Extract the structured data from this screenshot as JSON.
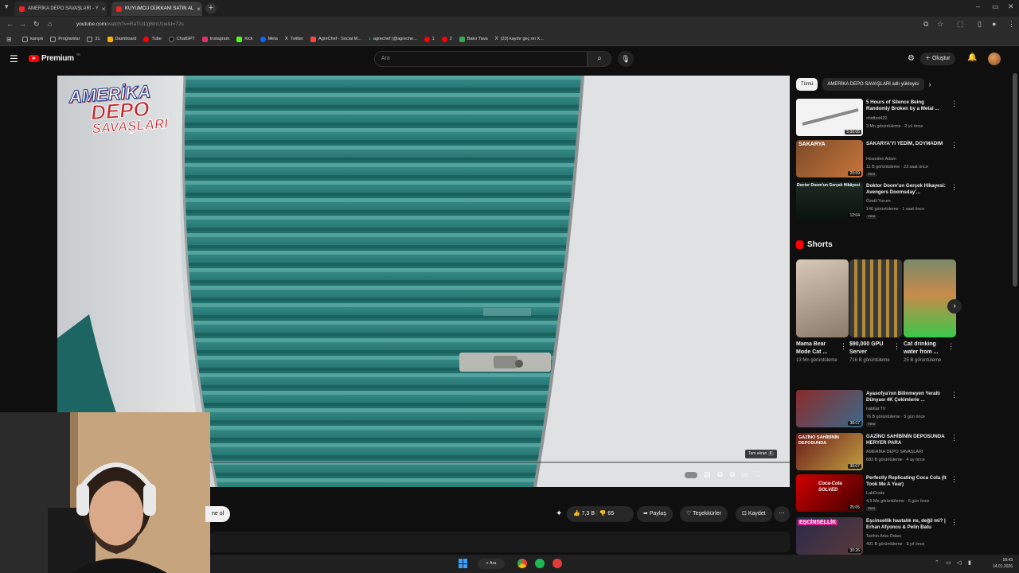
{
  "browser": {
    "tabs": [
      {
        "label": "AMERİKA DEPO SAVAŞLARI - Y"
      },
      {
        "label": "KUYUMCU DÜKKANI SATIN AL"
      }
    ],
    "url_host": "youtube.com",
    "url_path": "/watch?v=RaTU1lg8mU1w&t=72s",
    "bookmarks": [
      {
        "label": "karışık",
        "color": "#9aa0a6"
      },
      {
        "label": "Programlar",
        "color": "#9aa0a6"
      },
      {
        "label": "31",
        "color": "#9aa0a6"
      },
      {
        "label": "Dashboard",
        "color": "#f4b400"
      },
      {
        "label": "Tube",
        "color": "#ff0000"
      },
      {
        "label": "ChatGPT",
        "color": "#222222"
      },
      {
        "label": "Instagram",
        "color": "#e1306c"
      },
      {
        "label": "Kick",
        "color": "#53fc18"
      },
      {
        "label": "Meta",
        "color": "#0866ff"
      },
      {
        "label": "Twitter",
        "color": "#ffffff"
      },
      {
        "label": "AgreChef - Social M...",
        "color": "#ff4444"
      },
      {
        "label": "agrechef (@agreche...",
        "color": "#25f4ee"
      },
      {
        "label": "1",
        "color": "#ff0000"
      },
      {
        "label": "2",
        "color": "#ff0000"
      },
      {
        "label": "Bakır Tava",
        "color": "#34a853"
      },
      {
        "label": "(20) kaydır geç on X...",
        "color": "#ffffff"
      }
    ]
  },
  "youtube": {
    "logo_text": "Premium",
    "logo_sup": "TR",
    "search_placeholder": "Ara",
    "create_label": "Oluştur"
  },
  "player": {
    "overlay_logo_line1": "AMERİKA",
    "overlay_logo_line2": "DEPO",
    "overlay_logo_line3": "SAVAŞLARI",
    "tooltip": "Tam ekran",
    "tooltip_key": "F"
  },
  "actions": {
    "subscribe_fragment": "ne ol",
    "likes": "7,3 B",
    "dislikes": "65",
    "share": "Paylaş",
    "thanks": "Teşekkürler",
    "save": "Kaydet"
  },
  "sidebar": {
    "chips": [
      {
        "label": "Tümü"
      },
      {
        "label": "AMERİKA DEPO SAVAŞLARI adlı yükleyici"
      }
    ],
    "shorts_title": "Shorts",
    "videos_top": [
      {
        "title": "5 Hours of Silence Being Randomly Broken by a Metal ...",
        "channel": "shidbot420",
        "meta": "3 Mn görüntüleme · 2 yıl önce",
        "badge": "",
        "duration": "5:00:05"
      },
      {
        "title": "SAKARYA'YI YEDİM, DOYMADIM",
        "channel": "Hisseden Adam",
        "meta": "11 B görüntüleme · 23 saat önce",
        "badge": "Yeni",
        "duration": "20:59",
        "thumb_text": "SAKARYA"
      },
      {
        "title": "Doktor Doom'un Gerçek Hikayesi: Avengers Doomsday'...",
        "channel": "Özetli Yorum",
        "meta": "146 görüntüleme · 1 saat önce",
        "badge": "Yeni",
        "duration": "12:04",
        "thumb_text": "Doctor Doom'un Gerçek Hikâyesi"
      }
    ],
    "shorts": [
      {
        "title": "Mama Bear Mode Cat ...",
        "views": "13 Mn görüntüleme"
      },
      {
        "title": "$90,000 GPU Server",
        "views": "716 B görüntüleme"
      },
      {
        "title": "Cat drinking water from ...",
        "views": "25 B görüntüleme"
      }
    ],
    "videos_bottom": [
      {
        "title": "Ayasofya'nın Bilinmeyen Yeraltı Dünyası 4K Çekimlerle ...",
        "channel": "habitat TV",
        "meta": "76 B görüntüleme · 5 gün önce",
        "badge": "Yeni",
        "duration": "38:07"
      },
      {
        "title": "GAZİNO SAHİBİNİN DEPOSUNDA HERYER PARA",
        "channel": "AMERİKA DEPO SAVAŞLARI",
        "meta": "883 B görüntüleme · 4 ay önce",
        "badge": "",
        "duration": "38:07",
        "thumb_text": "GAZİNO SAHİBİNİN DEPOSUNDA"
      },
      {
        "title": "Perfectly Replicating Coca Cola (It Took Me A Year)",
        "channel": "LabCoatz",
        "meta": "4,5 Mn görüntüleme · 6 gün önce",
        "badge": "Yeni",
        "duration": "25:05",
        "thumb_text": "Coca-Cola SOLVED"
      },
      {
        "title": "Eşcinsellik hastalık mı, değil mi? | Erhan Afyoncu & Pelin Batu",
        "channel": "Tarihin Arka Odası",
        "meta": "491 B görüntüleme · 3 yıl önce",
        "badge": "",
        "duration": "30:26",
        "thumb_text": "EŞCİNSELLİK"
      }
    ]
  },
  "taskbar": {
    "search": "Ara",
    "time": "18:43",
    "date": "14.01.2026"
  }
}
